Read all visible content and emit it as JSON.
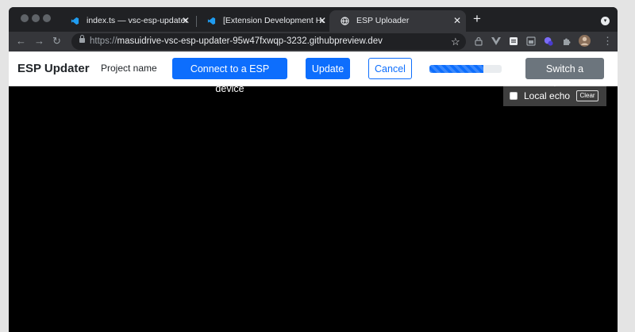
{
  "browser": {
    "tabs": [
      {
        "title": "index.ts — vsc-esp-updater [C",
        "active": false
      },
      {
        "title": "[Extension Development Host]",
        "active": false
      },
      {
        "title": "ESP Uploader",
        "active": true
      }
    ],
    "new_tab_label": "+",
    "url_scheme": "https://",
    "url_host": "masuidrive-vsc-esp-updater-95w47fxwqp-3232.githubpreview.dev",
    "extension_badge": "1"
  },
  "app": {
    "brand": "ESP Updater",
    "project_name": "Project name",
    "connect_label": "Connect to a ESP device",
    "update_label": "Update",
    "cancel_label": "Cancel",
    "progress_fraction": 0.75,
    "switch_label": "Switch a device",
    "local_echo_label": "Local echo",
    "local_echo_checked": false,
    "clear_label": "Clear"
  },
  "colors": {
    "primary": "#0d6efd",
    "secondary": "#6c757d",
    "terminal_bg": "#000000",
    "browser_dark": "#202124"
  }
}
